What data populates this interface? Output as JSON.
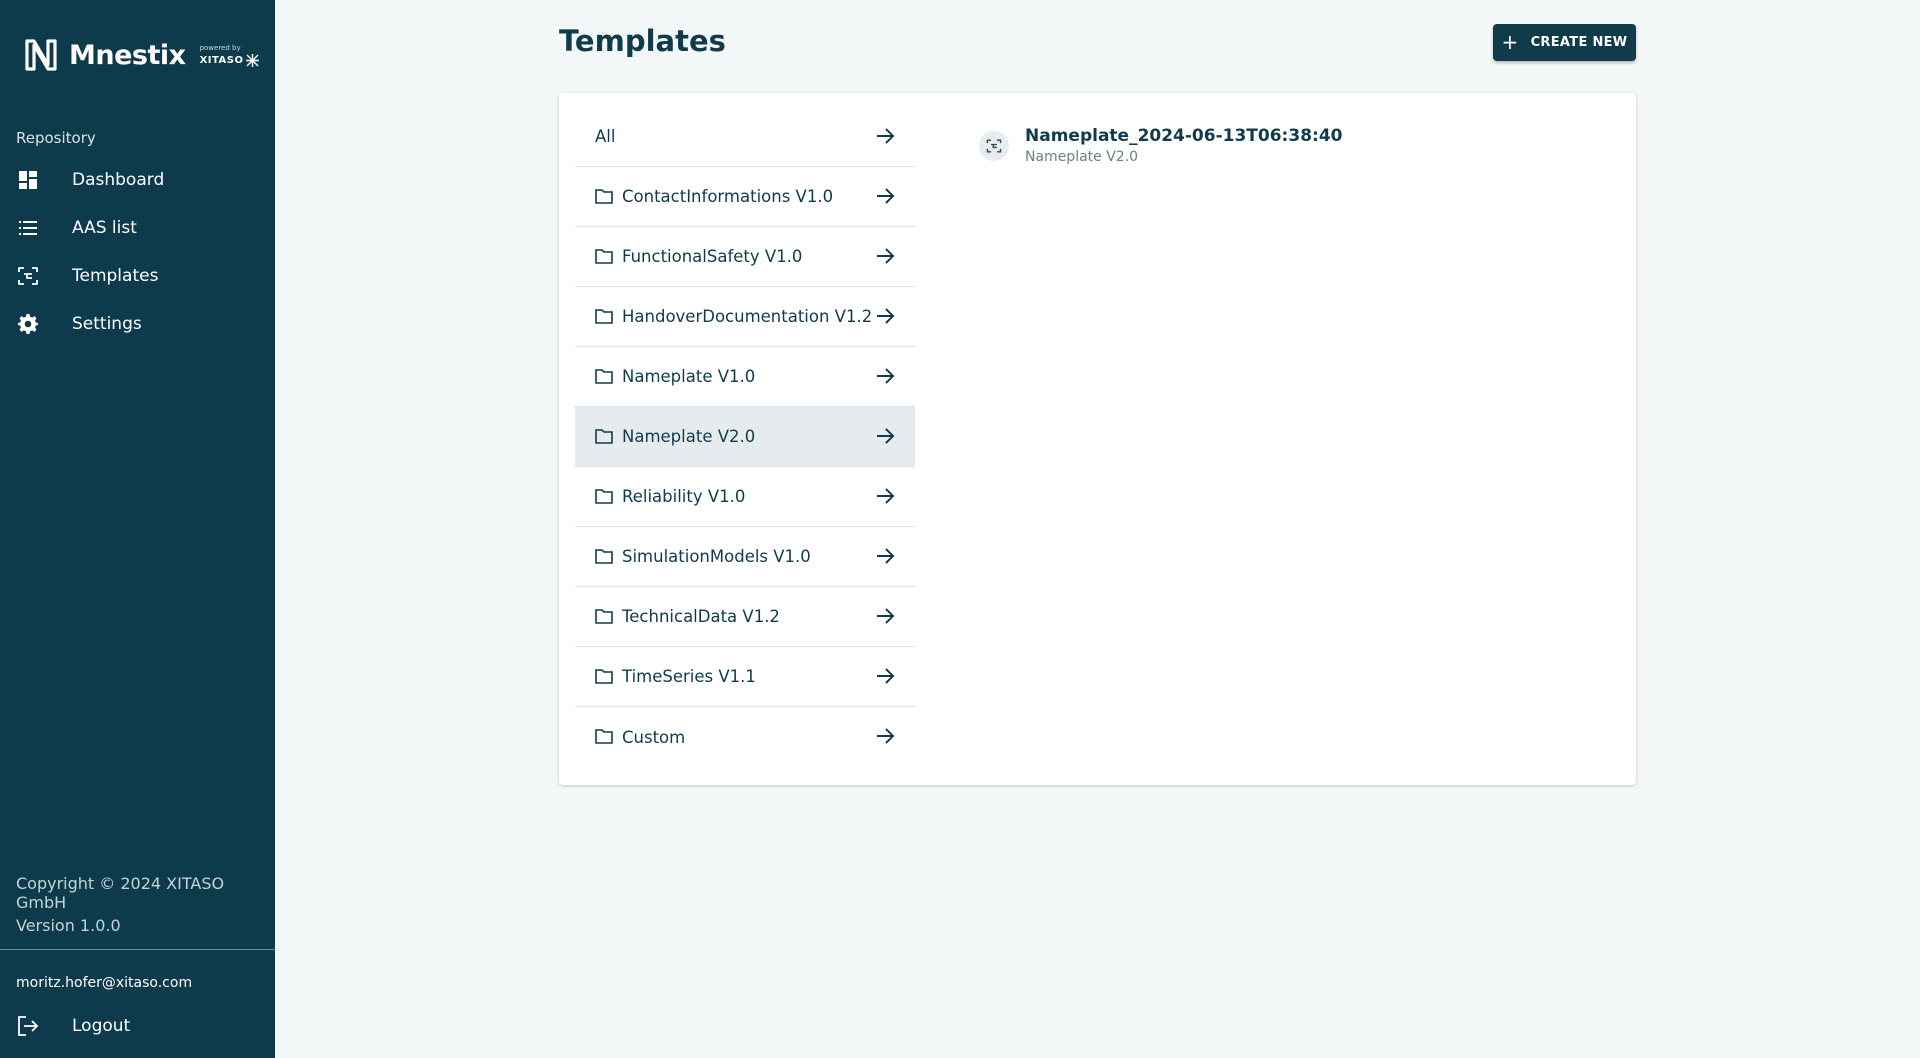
{
  "brand": {
    "name": "Mnestix",
    "powered_label": "powered by",
    "powered_brand": "XITASO"
  },
  "sidebar": {
    "section_label": "Repository",
    "items": [
      {
        "label": "Dashboard",
        "icon": "dashboard-icon"
      },
      {
        "label": "AAS list",
        "icon": "list-icon"
      },
      {
        "label": "Templates",
        "icon": "template-icon"
      },
      {
        "label": "Settings",
        "icon": "gear-icon"
      }
    ],
    "copyright": "Copyright © 2024 XITASO GmbH",
    "version": "Version 1.0.0",
    "user_email": "moritz.hofer@xitaso.com",
    "logout_label": "Logout"
  },
  "header": {
    "title": "Templates",
    "create_button": "CREATE NEW"
  },
  "categories": [
    {
      "label": "All",
      "has_folder": false,
      "selected": false
    },
    {
      "label": "ContactInformations V1.0",
      "has_folder": true,
      "selected": false
    },
    {
      "label": "FunctionalSafety V1.0",
      "has_folder": true,
      "selected": false
    },
    {
      "label": "HandoverDocumentation V1.2",
      "has_folder": true,
      "selected": false
    },
    {
      "label": "Nameplate V1.0",
      "has_folder": true,
      "selected": false
    },
    {
      "label": "Nameplate V2.0",
      "has_folder": true,
      "selected": true
    },
    {
      "label": "Reliability V1.0",
      "has_folder": true,
      "selected": false
    },
    {
      "label": "SimulationModels V1.0",
      "has_folder": true,
      "selected": false
    },
    {
      "label": "TechnicalData V1.2",
      "has_folder": true,
      "selected": false
    },
    {
      "label": "TimeSeries V1.1",
      "has_folder": true,
      "selected": false
    },
    {
      "label": "Custom",
      "has_folder": true,
      "selected": false
    }
  ],
  "templates": [
    {
      "title": "Nameplate_2024-06-13T06:38:40",
      "subtitle": "Nameplate V2.0"
    }
  ],
  "colors": {
    "sidebar_bg": "#0d3b4b",
    "primary": "#0f3b4b",
    "page_bg": "#f4f7f8",
    "selected_row": "#e6ecee"
  }
}
